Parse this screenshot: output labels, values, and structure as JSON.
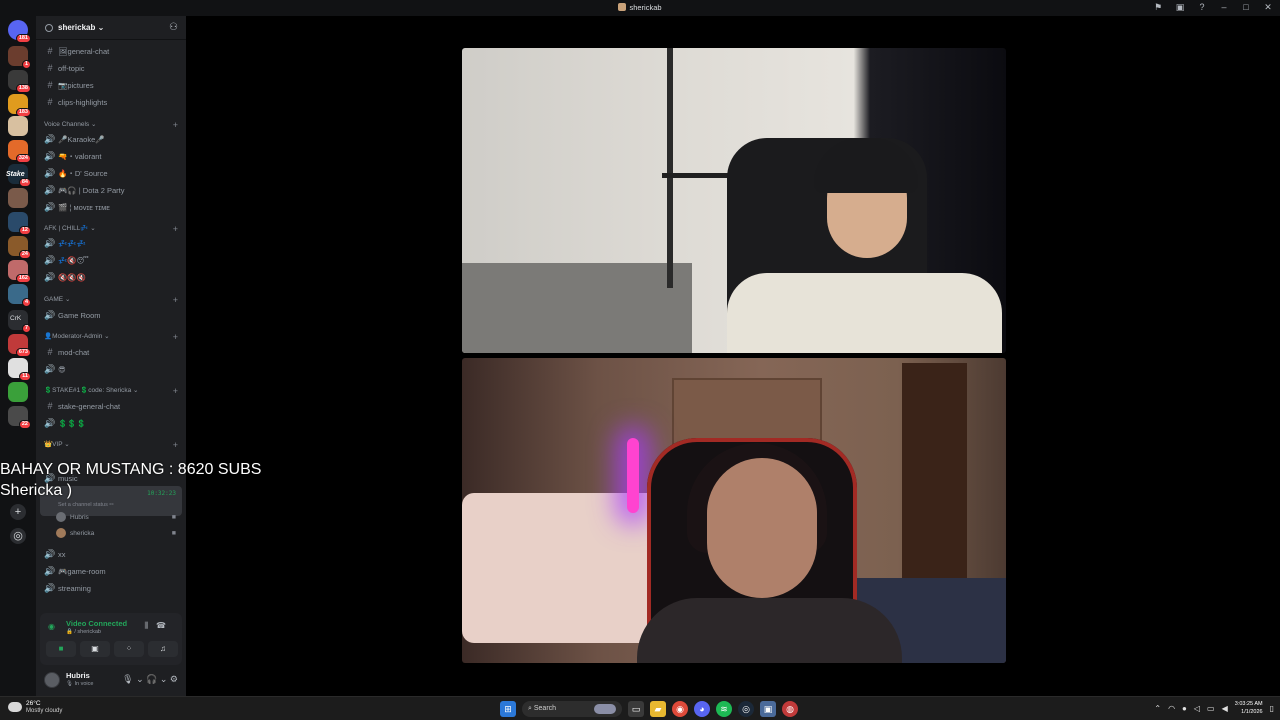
{
  "window": {
    "title": "sherickab"
  },
  "rail": {
    "servers": [
      {
        "badge": "181",
        "color": "#5865f2"
      },
      {
        "badge": "1",
        "color": "#6b3d2e"
      },
      {
        "badge": "138",
        "color": "#3a3a3a"
      },
      {
        "badge": "183",
        "color": "#e09b1e"
      },
      {
        "badge": "",
        "color": "#d8c0a0"
      },
      {
        "badge": "324",
        "color": "#e36a2a"
      },
      {
        "badge": "84",
        "color": "#1a2c3a"
      },
      {
        "badge": "",
        "color": "#7a5a4a"
      },
      {
        "badge": "12",
        "color": "#2a4a6a"
      },
      {
        "badge": "24",
        "color": "#8a5a2a"
      },
      {
        "badge": "162",
        "color": "#c06a6a"
      },
      {
        "badge": "4",
        "color": "#3a6a8a"
      },
      {
        "badge": "7",
        "color": "#2b2d31"
      },
      {
        "badge": "673",
        "color": "#c03a3a"
      },
      {
        "badge": "11",
        "color": "#e0e0e0"
      },
      {
        "badge": "",
        "color": "#3aa03a"
      },
      {
        "badge": "22",
        "color": "#4a4a4a"
      }
    ],
    "stake_label": "Stake",
    "crk_label": "CrK"
  },
  "server": {
    "name": "sherickab"
  },
  "channels": {
    "general": "🖼general-chat",
    "offtopic": "off-topic",
    "pictures": "📷pictures",
    "clips": "clips-highlights",
    "cat_voice": "Voice Channels",
    "karaoke": "🎤Karaoke🎤",
    "valorant": "🔫・valorant",
    "dsource": "🔥・D' Source",
    "dota": "🎮🎧 | Dota 2 Party",
    "movie": "🎬 ¦ ᴍᴏᴠɪᴇ ᴛɪᴍᴇ",
    "cat_afk": "AFK | CHILL💤",
    "afk1": "💤💤💤",
    "afk2": "💤🔇😴",
    "afk3": "🔇🔇🔇",
    "cat_game": "GAME",
    "gameroom": "Game Room",
    "cat_mod": "👤Moderator-Admin",
    "modchat": "mod-chat",
    "modvoice": "😎",
    "cat_stake": "💲STAKE#1💲code: Shericka",
    "stakegeneral": "stake-general-chat",
    "stakevoice": "💲💲💲",
    "cat_vip": "👑VIP",
    "music": "music",
    "music_timer": "10:32:23",
    "music_status": "Set a channel status ✏",
    "user1": "Hubris",
    "user2": "shericka",
    "xx": "xx",
    "gameroom2": "🎮game-room",
    "streaming": "streaming"
  },
  "voice_panel": {
    "status": "Video Connected",
    "sub": "🔒 / sherickab"
  },
  "user": {
    "name": "Hubris",
    "status": "🎙 In voice"
  },
  "overlay": {
    "line1": "BAHAY OR MUSTANG : 8620 SUBS",
    "line2": "Shericka )"
  },
  "taskbar": {
    "temp": "26°C",
    "condition": "Mostly cloudy",
    "search": "Search",
    "time": "3:03:25 AM",
    "date": "1/1/2026"
  }
}
